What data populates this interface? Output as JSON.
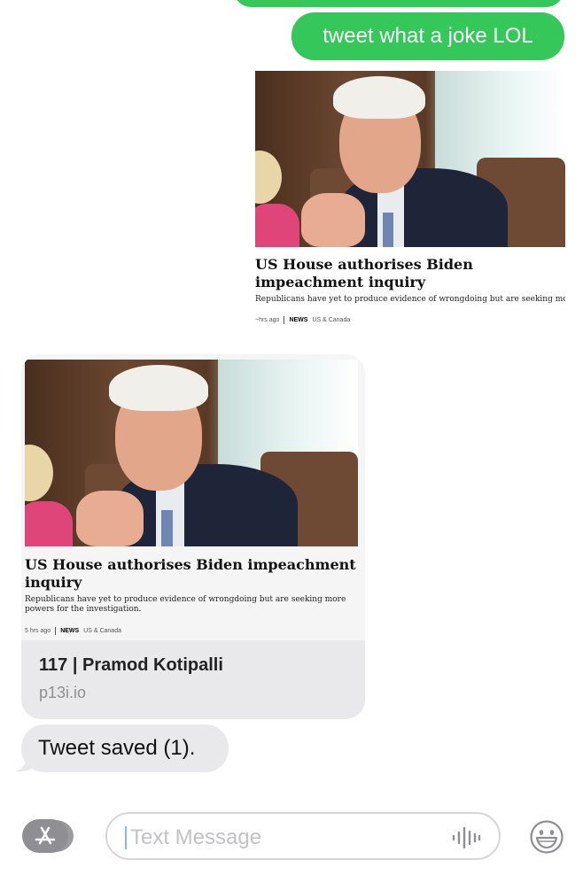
{
  "messages": {
    "sent_joke": "tweet what a joke LOL",
    "received_tweet_saved": "Tweet saved (1)."
  },
  "article_sent": {
    "headline": "US House authorises Biden impeachment inquiry",
    "description": "Republicans have yet to produce evidence of wrongdoing but are seeking more powers for the investigation.",
    "time": "~hrs ago",
    "category": "NEWS",
    "section": "US & Canada"
  },
  "article_received": {
    "headline": "US House authorises Biden impeachment inquiry",
    "description": "Republicans have yet to produce evidence of wrongdoing but are seeking more powers for the investigation.",
    "time": "5 hrs ago",
    "category": "NEWS",
    "section": "US & Canada",
    "link_title": "117 | Pramod Kotipalli",
    "link_domain": "p13i.io"
  },
  "compose": {
    "placeholder": "Text Message"
  },
  "colors": {
    "sent_bubble": "#35c759",
    "received_bubble": "#e9e9eb"
  },
  "icons": [
    "app-store-icon",
    "microphone-waveform-icon",
    "emoji-icon"
  ]
}
